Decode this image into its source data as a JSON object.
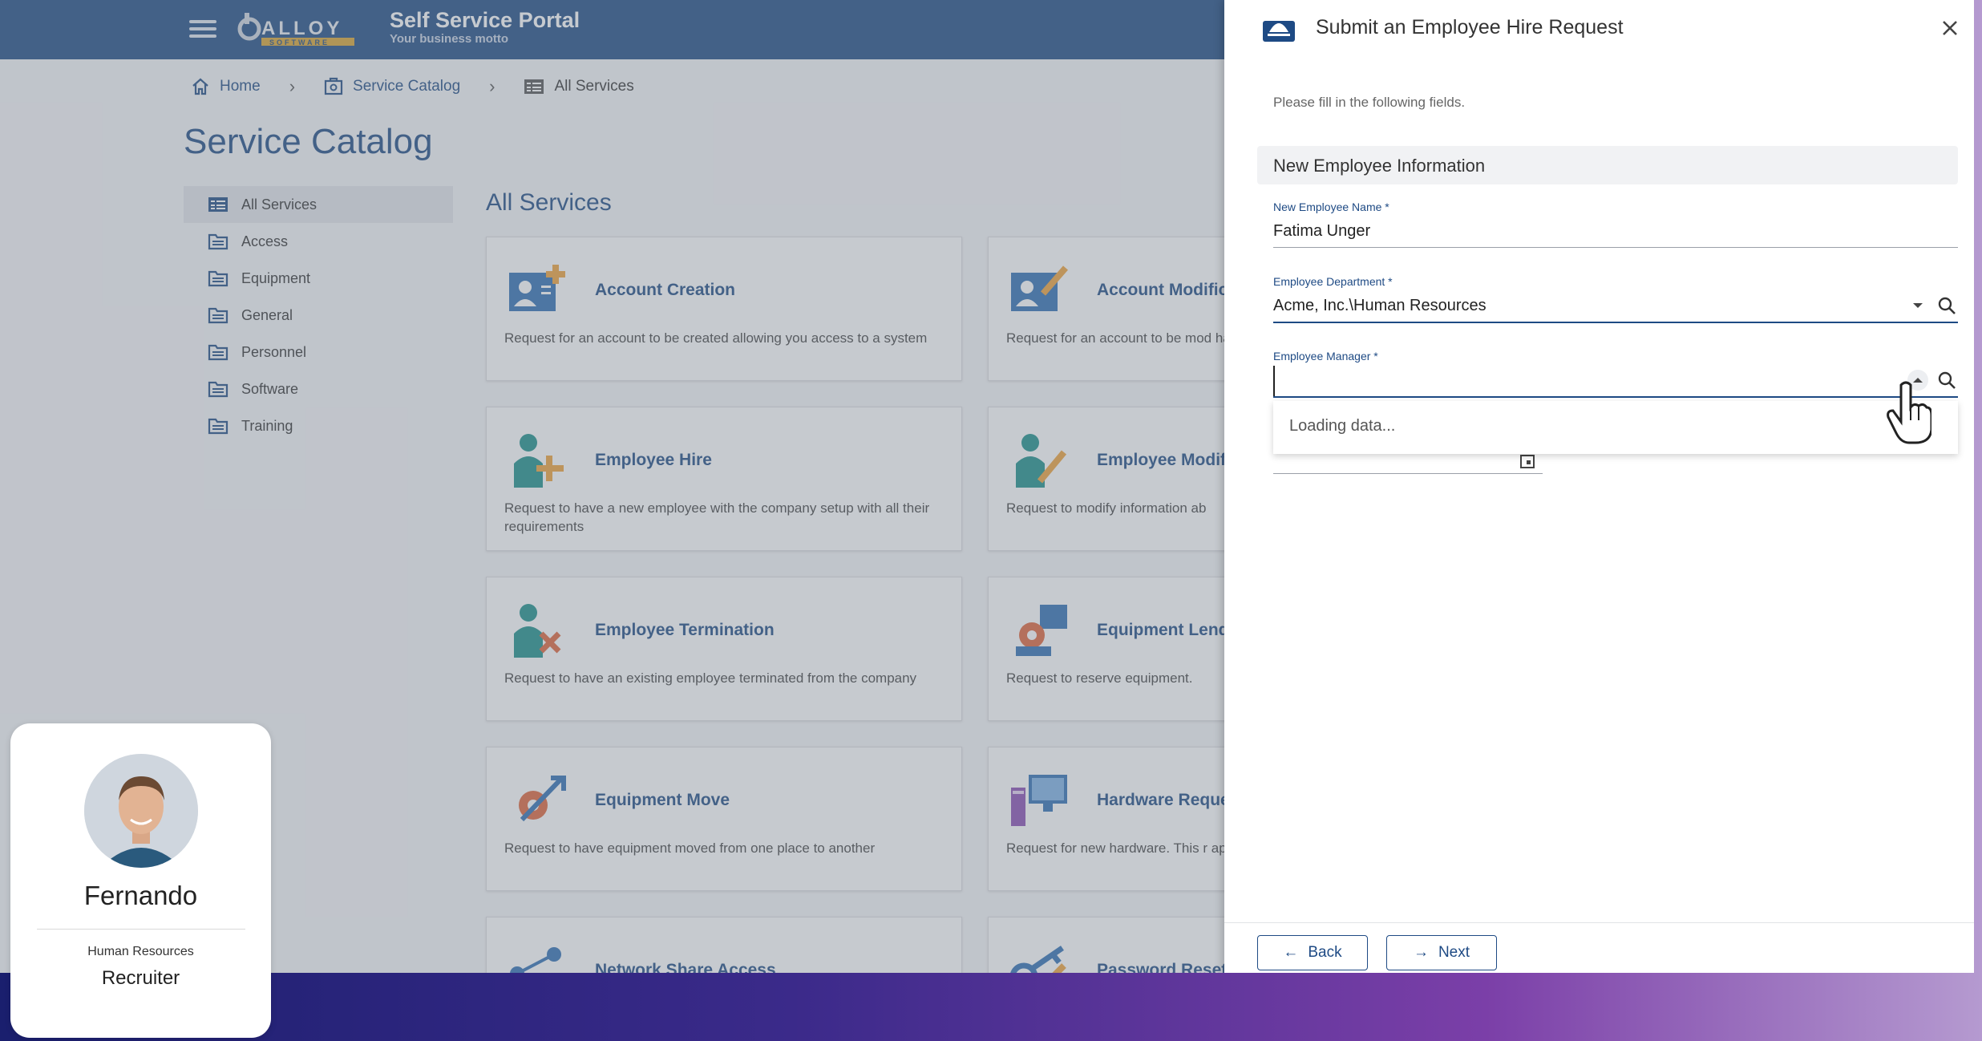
{
  "header": {
    "portal_title": "Self Service Portal",
    "portal_motto": "Your business motto",
    "logo_text": "ALLOY",
    "logo_subtext": "SOFTWARE"
  },
  "breadcrumb": {
    "home": "Home",
    "catalog": "Service Catalog",
    "current": "All Services"
  },
  "page_title": "Service Catalog",
  "sidebar": {
    "items": [
      {
        "label": "All Services",
        "active": true
      },
      {
        "label": "Access"
      },
      {
        "label": "Equipment"
      },
      {
        "label": "General"
      },
      {
        "label": "Personnel"
      },
      {
        "label": "Software"
      },
      {
        "label": "Training"
      }
    ]
  },
  "services_title": "All Services",
  "cards": [
    {
      "title": "Account Creation",
      "desc": "Request for an account to be created allowing you access to a system",
      "icon": "account-creation-icon"
    },
    {
      "title": "Account Modifica",
      "desc": "Request for an account to be mod have an account for",
      "icon": "account-modification-icon"
    },
    {
      "title": "Employee Hire",
      "desc": "Request to have a new employee with the company setup with all their requirements",
      "icon": "employee-hire-icon"
    },
    {
      "title": "Employee Modifi",
      "desc": "Request to modify information ab",
      "icon": "employee-modification-icon"
    },
    {
      "title": "Employee Termination",
      "desc": "Request to have an existing employee terminated from the company",
      "icon": "employee-termination-icon"
    },
    {
      "title": "Equipment Lendi",
      "desc": "Request to reserve equipment.",
      "icon": "equipment-lending-icon"
    },
    {
      "title": "Equipment Move",
      "desc": "Request to have equipment moved from one place to another",
      "icon": "equipment-move-icon"
    },
    {
      "title": "Hardware Reques",
      "desc": "Request for new hardware. This r approval. The Requester's Manag",
      "icon": "hardware-request-icon"
    },
    {
      "title": "Network Share Access",
      "desc": "",
      "icon": "network-share-icon"
    },
    {
      "title": "Password Reset",
      "desc": "",
      "icon": "password-reset-icon"
    }
  ],
  "drawer": {
    "title": "Submit an Employee Hire Request",
    "instructions": "Please fill in the following fields.",
    "section": "New Employee Information",
    "fields": {
      "name": {
        "label": "New Employee Name *",
        "value": "Fatima Unger"
      },
      "department": {
        "label": "Employee Department *",
        "value": "Acme, Inc.\\Human Resources"
      },
      "manager": {
        "label": "Employee Manager *",
        "value": "",
        "placeholder": ""
      }
    },
    "dropdown_status": "Loading data...",
    "back_label": "Back",
    "next_label": "Next"
  },
  "user": {
    "name": "Fernando",
    "department": "Human Resources",
    "role": "Recruiter"
  },
  "colors": {
    "brand": "#1e4a84",
    "accent_gold": "#d9a431",
    "icon_blue": "#2f6fb3",
    "icon_teal": "#1d8f8a",
    "icon_orange": "#f0a33a"
  }
}
